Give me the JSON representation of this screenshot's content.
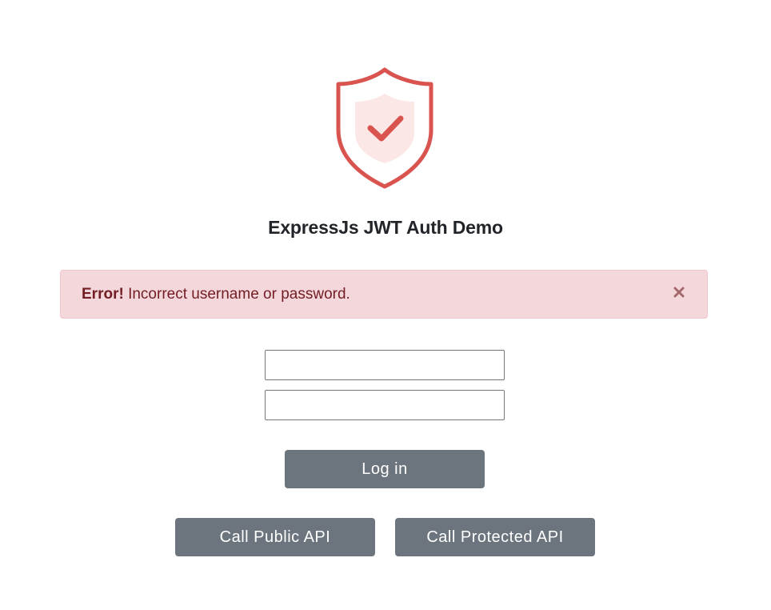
{
  "app": {
    "title": "ExpressJs JWT Auth Demo",
    "logo_icon": "shield-check-icon",
    "accent_color": "#d9534f"
  },
  "alert": {
    "strong": "Error!",
    "message": "Incorrect username or password.",
    "close_icon": "close-icon",
    "background": "#f3d7da",
    "text_color": "#721c24"
  },
  "form": {
    "username": {
      "value": "",
      "placeholder": ""
    },
    "password": {
      "value": "",
      "placeholder": ""
    },
    "login_label": "Log in"
  },
  "actions": {
    "public_api_label": "Call Public API",
    "protected_api_label": "Call Protected API",
    "button_color": "#6c757d"
  }
}
